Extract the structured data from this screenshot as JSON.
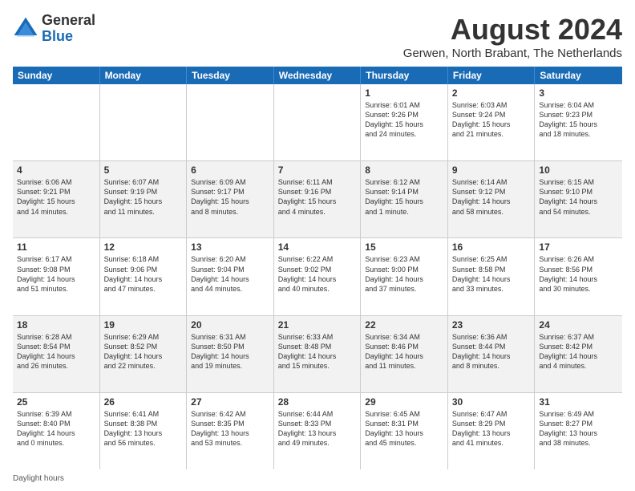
{
  "logo": {
    "general": "General",
    "blue": "Blue"
  },
  "title": {
    "month_year": "August 2024",
    "location": "Gerwen, North Brabant, The Netherlands"
  },
  "header_days": [
    "Sunday",
    "Monday",
    "Tuesday",
    "Wednesday",
    "Thursday",
    "Friday",
    "Saturday"
  ],
  "rows": [
    [
      {
        "day": "",
        "info": ""
      },
      {
        "day": "",
        "info": ""
      },
      {
        "day": "",
        "info": ""
      },
      {
        "day": "",
        "info": ""
      },
      {
        "day": "1",
        "info": "Sunrise: 6:01 AM\nSunset: 9:26 PM\nDaylight: 15 hours\nand 24 minutes."
      },
      {
        "day": "2",
        "info": "Sunrise: 6:03 AM\nSunset: 9:24 PM\nDaylight: 15 hours\nand 21 minutes."
      },
      {
        "day": "3",
        "info": "Sunrise: 6:04 AM\nSunset: 9:23 PM\nDaylight: 15 hours\nand 18 minutes."
      }
    ],
    [
      {
        "day": "4",
        "info": "Sunrise: 6:06 AM\nSunset: 9:21 PM\nDaylight: 15 hours\nand 14 minutes."
      },
      {
        "day": "5",
        "info": "Sunrise: 6:07 AM\nSunset: 9:19 PM\nDaylight: 15 hours\nand 11 minutes."
      },
      {
        "day": "6",
        "info": "Sunrise: 6:09 AM\nSunset: 9:17 PM\nDaylight: 15 hours\nand 8 minutes."
      },
      {
        "day": "7",
        "info": "Sunrise: 6:11 AM\nSunset: 9:16 PM\nDaylight: 15 hours\nand 4 minutes."
      },
      {
        "day": "8",
        "info": "Sunrise: 6:12 AM\nSunset: 9:14 PM\nDaylight: 15 hours\nand 1 minute."
      },
      {
        "day": "9",
        "info": "Sunrise: 6:14 AM\nSunset: 9:12 PM\nDaylight: 14 hours\nand 58 minutes."
      },
      {
        "day": "10",
        "info": "Sunrise: 6:15 AM\nSunset: 9:10 PM\nDaylight: 14 hours\nand 54 minutes."
      }
    ],
    [
      {
        "day": "11",
        "info": "Sunrise: 6:17 AM\nSunset: 9:08 PM\nDaylight: 14 hours\nand 51 minutes."
      },
      {
        "day": "12",
        "info": "Sunrise: 6:18 AM\nSunset: 9:06 PM\nDaylight: 14 hours\nand 47 minutes."
      },
      {
        "day": "13",
        "info": "Sunrise: 6:20 AM\nSunset: 9:04 PM\nDaylight: 14 hours\nand 44 minutes."
      },
      {
        "day": "14",
        "info": "Sunrise: 6:22 AM\nSunset: 9:02 PM\nDaylight: 14 hours\nand 40 minutes."
      },
      {
        "day": "15",
        "info": "Sunrise: 6:23 AM\nSunset: 9:00 PM\nDaylight: 14 hours\nand 37 minutes."
      },
      {
        "day": "16",
        "info": "Sunrise: 6:25 AM\nSunset: 8:58 PM\nDaylight: 14 hours\nand 33 minutes."
      },
      {
        "day": "17",
        "info": "Sunrise: 6:26 AM\nSunset: 8:56 PM\nDaylight: 14 hours\nand 30 minutes."
      }
    ],
    [
      {
        "day": "18",
        "info": "Sunrise: 6:28 AM\nSunset: 8:54 PM\nDaylight: 14 hours\nand 26 minutes."
      },
      {
        "day": "19",
        "info": "Sunrise: 6:29 AM\nSunset: 8:52 PM\nDaylight: 14 hours\nand 22 minutes."
      },
      {
        "day": "20",
        "info": "Sunrise: 6:31 AM\nSunset: 8:50 PM\nDaylight: 14 hours\nand 19 minutes."
      },
      {
        "day": "21",
        "info": "Sunrise: 6:33 AM\nSunset: 8:48 PM\nDaylight: 14 hours\nand 15 minutes."
      },
      {
        "day": "22",
        "info": "Sunrise: 6:34 AM\nSunset: 8:46 PM\nDaylight: 14 hours\nand 11 minutes."
      },
      {
        "day": "23",
        "info": "Sunrise: 6:36 AM\nSunset: 8:44 PM\nDaylight: 14 hours\nand 8 minutes."
      },
      {
        "day": "24",
        "info": "Sunrise: 6:37 AM\nSunset: 8:42 PM\nDaylight: 14 hours\nand 4 minutes."
      }
    ],
    [
      {
        "day": "25",
        "info": "Sunrise: 6:39 AM\nSunset: 8:40 PM\nDaylight: 14 hours\nand 0 minutes."
      },
      {
        "day": "26",
        "info": "Sunrise: 6:41 AM\nSunset: 8:38 PM\nDaylight: 13 hours\nand 56 minutes."
      },
      {
        "day": "27",
        "info": "Sunrise: 6:42 AM\nSunset: 8:35 PM\nDaylight: 13 hours\nand 53 minutes."
      },
      {
        "day": "28",
        "info": "Sunrise: 6:44 AM\nSunset: 8:33 PM\nDaylight: 13 hours\nand 49 minutes."
      },
      {
        "day": "29",
        "info": "Sunrise: 6:45 AM\nSunset: 8:31 PM\nDaylight: 13 hours\nand 45 minutes."
      },
      {
        "day": "30",
        "info": "Sunrise: 6:47 AM\nSunset: 8:29 PM\nDaylight: 13 hours\nand 41 minutes."
      },
      {
        "day": "31",
        "info": "Sunrise: 6:49 AM\nSunset: 8:27 PM\nDaylight: 13 hours\nand 38 minutes."
      }
    ]
  ],
  "footer": {
    "text": "Daylight hours"
  },
  "alt_rows": [
    1,
    3
  ]
}
